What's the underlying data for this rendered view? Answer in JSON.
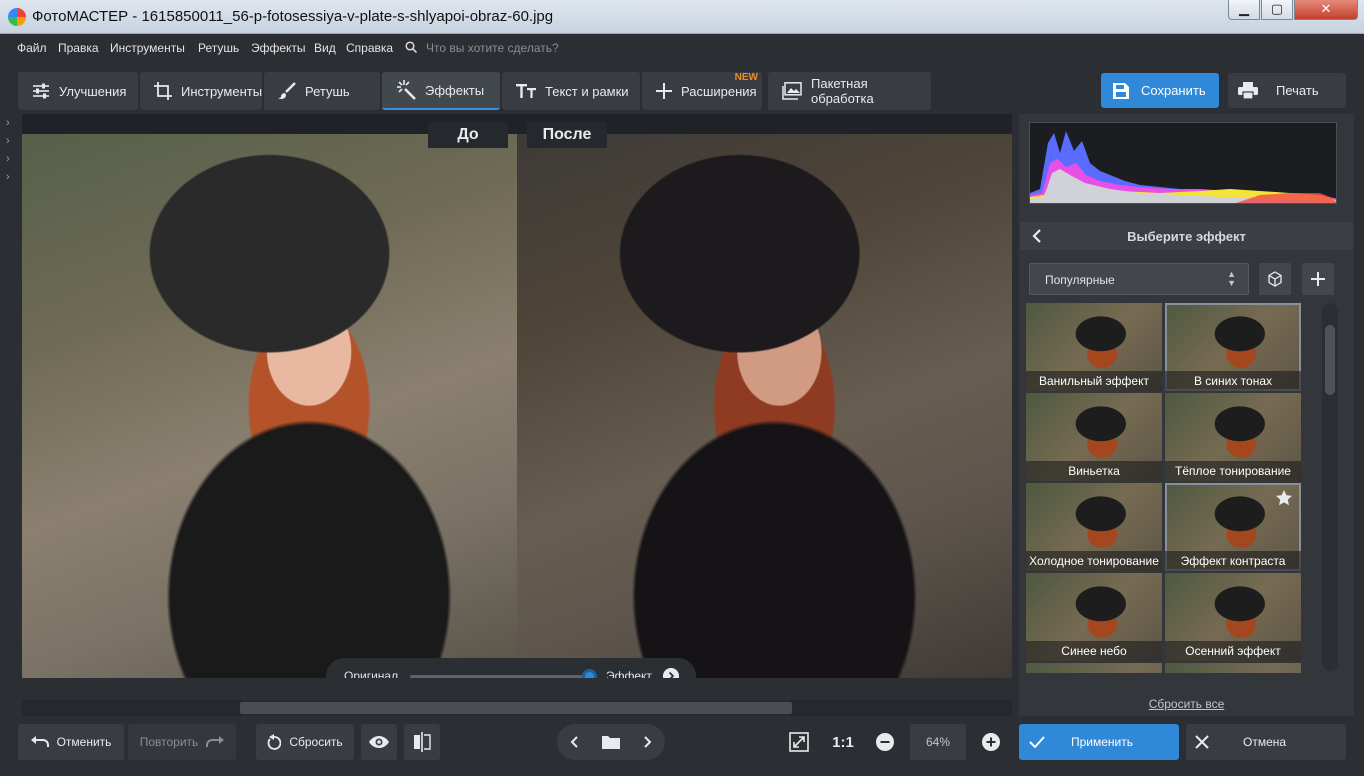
{
  "window": {
    "title": "ФотоМАСТЕР - 1615850011_56-p-fotosessiya-v-plate-s-shlyapoi-obraz-60.jpg",
    "min": "▁",
    "max": "▢",
    "close": "✕"
  },
  "menu": {
    "items": [
      "Файл",
      "Правка",
      "Инструменты",
      "Ретушь",
      "Эффекты",
      "Вид",
      "Справка"
    ],
    "search_placeholder": "Что вы хотите сделать?"
  },
  "tabs": [
    {
      "label": "Улучшения",
      "icon": "sliders-icon"
    },
    {
      "label": "Инструменты",
      "icon": "crop-icon"
    },
    {
      "label": "Ретушь",
      "icon": "brush-icon"
    },
    {
      "label": "Эффекты",
      "icon": "sparkle-icon",
      "active": true
    },
    {
      "label": "Текст и рамки",
      "icon": "text-icon"
    },
    {
      "label": "Расширения",
      "icon": "plus-icon",
      "badge": "NEW"
    },
    {
      "label": "Пакетная обработка",
      "icon": "images-icon"
    }
  ],
  "toolbar": {
    "save_label": "Сохранить",
    "print_label": "Печать"
  },
  "canvas": {
    "before_label": "До",
    "after_label": "После",
    "compare": {
      "original_label": "Оригинал",
      "effect_label": "Эффект",
      "position": 1.0
    }
  },
  "bottom": {
    "undo_label": "Отменить",
    "redo_label": "Повторить",
    "reset_label": "Сбросить",
    "zoom_1to1": "1:1",
    "zoom_value": "64%"
  },
  "panel": {
    "title": "Выберите эффект",
    "category": "Популярные",
    "effects": [
      {
        "label": "Ванильный эффект",
        "selected": false
      },
      {
        "label": "В синих тонах",
        "selected": true
      },
      {
        "label": "Виньетка",
        "selected": false
      },
      {
        "label": "Тёплое тонирование",
        "selected": false
      },
      {
        "label": "Холодное тонирование",
        "selected": false
      },
      {
        "label": "Эффект контраста",
        "selected": true,
        "favorite": true
      },
      {
        "label": "Синее небо",
        "selected": false
      },
      {
        "label": "Осенний эффект",
        "selected": false
      }
    ],
    "reset_all": "Сбросить все",
    "apply_label": "Применить",
    "cancel_label": "Отмена"
  },
  "colors": {
    "accent": "#2f88d8",
    "badge": "#f08a24"
  }
}
